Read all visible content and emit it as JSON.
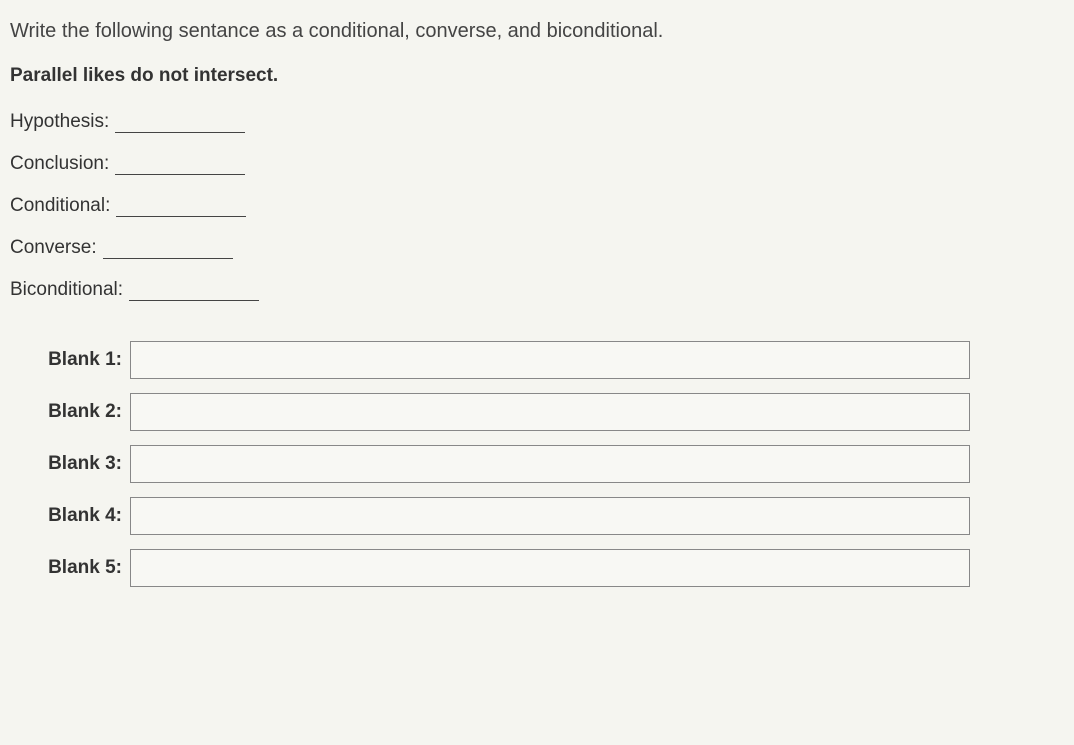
{
  "instruction": "Write the following sentance as a conditional, converse, and biconditional.",
  "statement": "Parallel likes do not intersect.",
  "prompts": {
    "hypothesis": "Hypothesis:",
    "conclusion": "Conclusion:",
    "conditional": "Conditional:",
    "converse": "Converse:",
    "biconditional": "Biconditional:"
  },
  "blanks": [
    {
      "label": "Blank 1:",
      "value": ""
    },
    {
      "label": "Blank 2:",
      "value": ""
    },
    {
      "label": "Blank 3:",
      "value": ""
    },
    {
      "label": "Blank 4:",
      "value": ""
    },
    {
      "label": "Blank 5:",
      "value": ""
    }
  ]
}
